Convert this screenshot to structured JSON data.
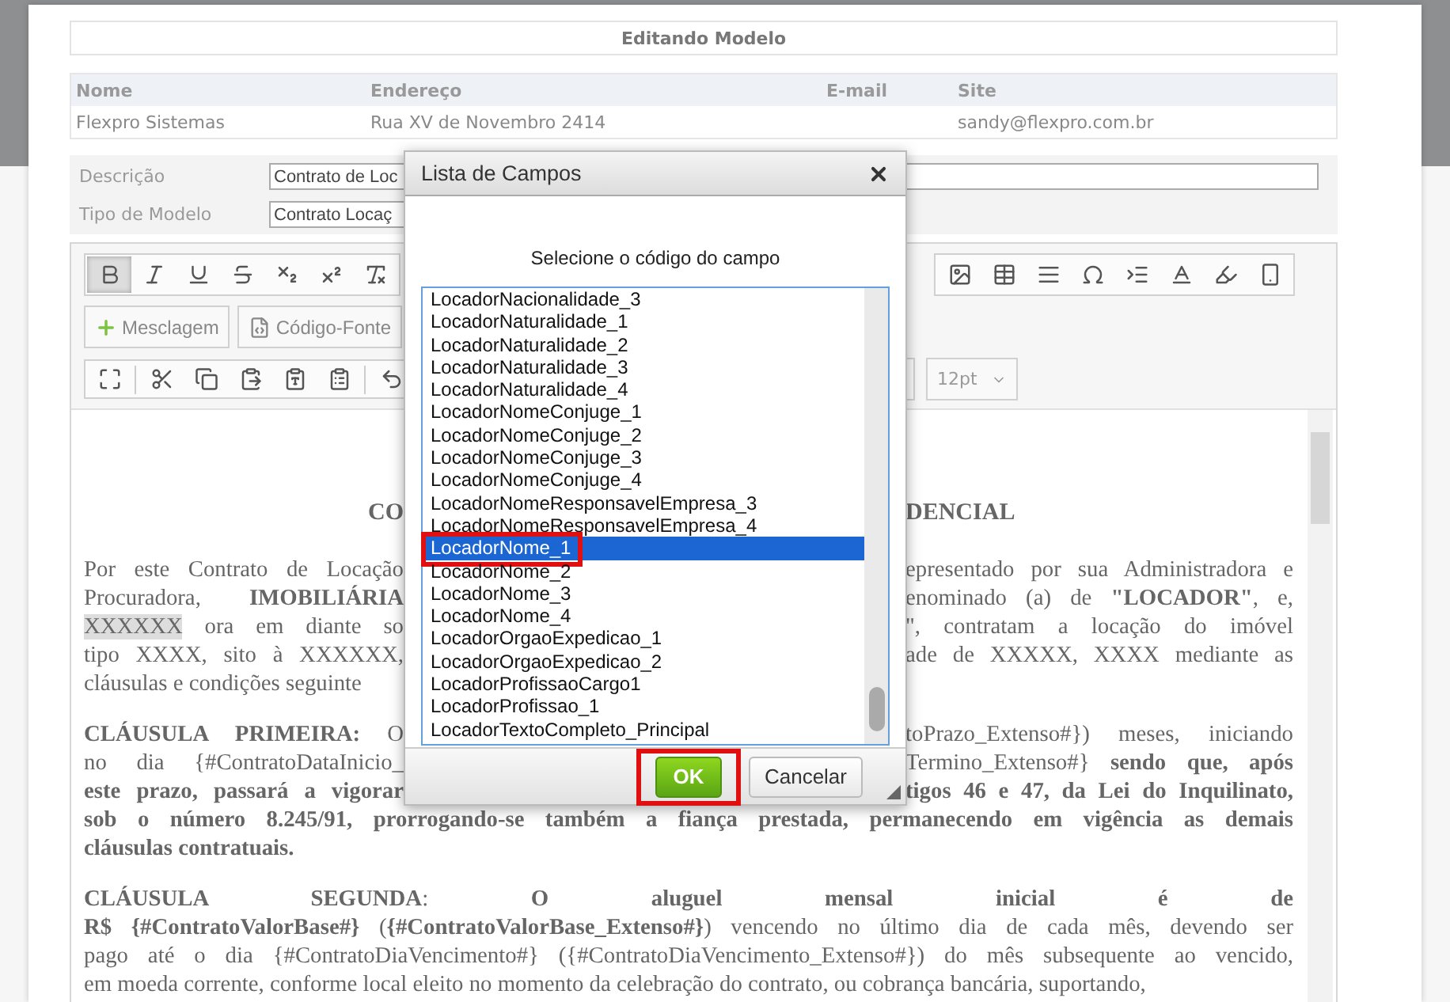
{
  "page": {
    "title": "Editando Modelo"
  },
  "info_table": {
    "columns": [
      "Nome",
      "Endereço",
      "E-mail",
      "Site"
    ],
    "row": {
      "name": "Flexpro Sistemas",
      "address": "Rua XV de Novembro 2414",
      "site": "sandy@flexpro.com.br"
    }
  },
  "form": {
    "fields": [
      {
        "label": "Descrição",
        "value": "Contrato de Loc",
        "kind": "text"
      },
      {
        "label": "Tipo de Modelo",
        "value": "Contrato Locaç",
        "kind": "select"
      }
    ]
  },
  "editor": {
    "bold_pressed": true,
    "buttons": [
      {
        "label": "Mesclagem",
        "kind": "merge"
      },
      {
        "label": "Código-Fonte",
        "kind": "source"
      }
    ],
    "font_size": "12pt",
    "document": {
      "title_left": "CO",
      "title_right": "DENCIAL",
      "paragraphs": [
        {
          "lines": [
            {
              "left": "Por este Contrato de Locação",
              "right": "epresentado por sua Administradora e"
            },
            {
              "left": "Procuradora, **IMOBILIÁRIA**",
              "right": "enominado (a) de **\"LOCADOR\"**, e,"
            },
            {
              "marked": "XXXXXX",
              "left": "ora em diante so",
              "right": "\", contratam a locação do imóvel"
            },
            {
              "left": "tipo XXXX, sito à XXXXXX,",
              "right": "ade de XXXXX, XXXX mediante as"
            },
            {
              "left": "cláusulas e condições seguinte"
            }
          ]
        },
        {
          "lines": [
            {
              "left": "**CLÁUSULA PRIMEIRA:** O",
              "right": "toPrazo_Extenso#}) meses, iniciando"
            },
            {
              "left": "no dia {#ContratoDataInicio_",
              "right": "Termino_Extenso#} **sendo que, após**"
            },
            {
              "left": "**este prazo, passará a vigorar**",
              "right": "**tigos 46 e 47, da Lei do Inquilinato,**"
            },
            {
              "full": "**sob o número 8.245/91, prorrogando-se também a fiança prestada, permanecendo em vigência as demais**"
            },
            {
              "full": "**cláusulas contratuais.**"
            }
          ]
        },
        {
          "lines": [
            {
              "full": "**CLÁUSULA SEGUNDA**: **O aluguel mensal inicial é de**"
            },
            {
              "full": "**R$ {#ContratoValorBase#}** (**{#ContratoValorBase_Extenso#}**) vencendo no último dia de cada mês, devendo ser"
            },
            {
              "full": "pago até o dia {#ContratoDiaVencimento#} ({#ContratoDiaVencimento_Extenso#}) do mês subsequente ao vencido,"
            },
            {
              "full": "em moeda corrente, conforme local eleito no momento da celebração do contrato, ou cobrança bancária, suportando,"
            }
          ]
        }
      ]
    }
  },
  "dialog": {
    "title": "Lista de Campos",
    "prompt": "Selecione o código do campo",
    "options": [
      {
        "label": "LocadorNacionalidade_3",
        "selected": false,
        "annotated": false
      },
      {
        "label": "LocadorNaturalidade_1",
        "selected": false,
        "annotated": false
      },
      {
        "label": "LocadorNaturalidade_2",
        "selected": false,
        "annotated": false
      },
      {
        "label": "LocadorNaturalidade_3",
        "selected": false,
        "annotated": false
      },
      {
        "label": "LocadorNaturalidade_4",
        "selected": false,
        "annotated": false
      },
      {
        "label": "LocadorNomeConjuge_1",
        "selected": false,
        "annotated": false
      },
      {
        "label": "LocadorNomeConjuge_2",
        "selected": false,
        "annotated": false
      },
      {
        "label": "LocadorNomeConjuge_3",
        "selected": false,
        "annotated": false
      },
      {
        "label": "LocadorNomeConjuge_4",
        "selected": false,
        "annotated": false
      },
      {
        "label": "LocadorNomeResponsavelEmpresa_3",
        "selected": false,
        "annotated": false
      },
      {
        "label": "LocadorNomeResponsavelEmpresa_4",
        "selected": false,
        "annotated": false
      },
      {
        "label": "LocadorNome_1",
        "selected": true,
        "annotated": true
      },
      {
        "label": "LocadorNome_2",
        "selected": false,
        "annotated": false
      },
      {
        "label": "LocadorNome_3",
        "selected": false,
        "annotated": false
      },
      {
        "label": "LocadorNome_4",
        "selected": false,
        "annotated": false
      },
      {
        "label": "LocadorOrgaoExpedicao_1",
        "selected": false,
        "annotated": false
      },
      {
        "label": "LocadorOrgaoExpedicao_2",
        "selected": false,
        "annotated": false
      },
      {
        "label": "LocadorProfissaoCargo1",
        "selected": false,
        "annotated": false
      },
      {
        "label": "LocadorProfissao_1",
        "selected": false,
        "annotated": false
      },
      {
        "label": "LocadorTextoCompleto_Principal",
        "selected": false,
        "annotated": false
      }
    ],
    "buttons": [
      {
        "label": "OK",
        "kind": "primary",
        "annotated": true
      },
      {
        "label": "Cancelar",
        "kind": "secondary",
        "annotated": false
      }
    ]
  }
}
